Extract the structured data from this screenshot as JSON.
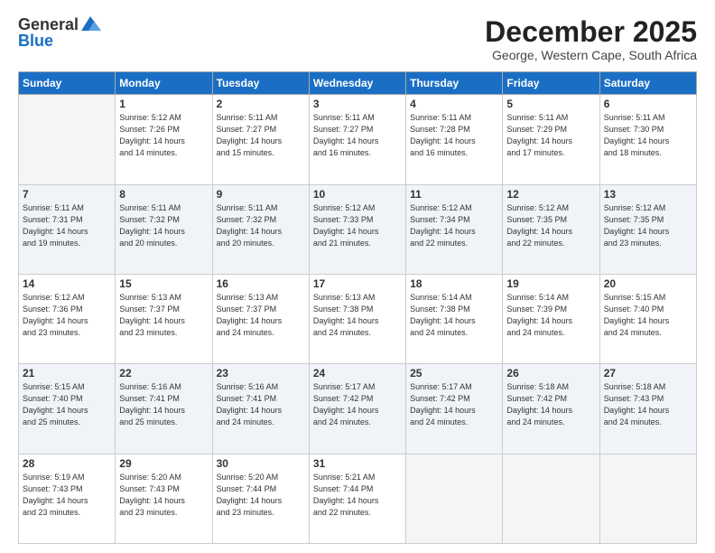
{
  "logo": {
    "general": "General",
    "blue": "Blue"
  },
  "title": "December 2025",
  "location": "George, Western Cape, South Africa",
  "days_of_week": [
    "Sunday",
    "Monday",
    "Tuesday",
    "Wednesday",
    "Thursday",
    "Friday",
    "Saturday"
  ],
  "weeks": [
    [
      {
        "day": "",
        "info": ""
      },
      {
        "day": "1",
        "info": "Sunrise: 5:12 AM\nSunset: 7:26 PM\nDaylight: 14 hours\nand 14 minutes."
      },
      {
        "day": "2",
        "info": "Sunrise: 5:11 AM\nSunset: 7:27 PM\nDaylight: 14 hours\nand 15 minutes."
      },
      {
        "day": "3",
        "info": "Sunrise: 5:11 AM\nSunset: 7:27 PM\nDaylight: 14 hours\nand 16 minutes."
      },
      {
        "day": "4",
        "info": "Sunrise: 5:11 AM\nSunset: 7:28 PM\nDaylight: 14 hours\nand 16 minutes."
      },
      {
        "day": "5",
        "info": "Sunrise: 5:11 AM\nSunset: 7:29 PM\nDaylight: 14 hours\nand 17 minutes."
      },
      {
        "day": "6",
        "info": "Sunrise: 5:11 AM\nSunset: 7:30 PM\nDaylight: 14 hours\nand 18 minutes."
      }
    ],
    [
      {
        "day": "7",
        "info": "Sunrise: 5:11 AM\nSunset: 7:31 PM\nDaylight: 14 hours\nand 19 minutes."
      },
      {
        "day": "8",
        "info": "Sunrise: 5:11 AM\nSunset: 7:32 PM\nDaylight: 14 hours\nand 20 minutes."
      },
      {
        "day": "9",
        "info": "Sunrise: 5:11 AM\nSunset: 7:32 PM\nDaylight: 14 hours\nand 20 minutes."
      },
      {
        "day": "10",
        "info": "Sunrise: 5:12 AM\nSunset: 7:33 PM\nDaylight: 14 hours\nand 21 minutes."
      },
      {
        "day": "11",
        "info": "Sunrise: 5:12 AM\nSunset: 7:34 PM\nDaylight: 14 hours\nand 22 minutes."
      },
      {
        "day": "12",
        "info": "Sunrise: 5:12 AM\nSunset: 7:35 PM\nDaylight: 14 hours\nand 22 minutes."
      },
      {
        "day": "13",
        "info": "Sunrise: 5:12 AM\nSunset: 7:35 PM\nDaylight: 14 hours\nand 23 minutes."
      }
    ],
    [
      {
        "day": "14",
        "info": "Sunrise: 5:12 AM\nSunset: 7:36 PM\nDaylight: 14 hours\nand 23 minutes."
      },
      {
        "day": "15",
        "info": "Sunrise: 5:13 AM\nSunset: 7:37 PM\nDaylight: 14 hours\nand 23 minutes."
      },
      {
        "day": "16",
        "info": "Sunrise: 5:13 AM\nSunset: 7:37 PM\nDaylight: 14 hours\nand 24 minutes."
      },
      {
        "day": "17",
        "info": "Sunrise: 5:13 AM\nSunset: 7:38 PM\nDaylight: 14 hours\nand 24 minutes."
      },
      {
        "day": "18",
        "info": "Sunrise: 5:14 AM\nSunset: 7:38 PM\nDaylight: 14 hours\nand 24 minutes."
      },
      {
        "day": "19",
        "info": "Sunrise: 5:14 AM\nSunset: 7:39 PM\nDaylight: 14 hours\nand 24 minutes."
      },
      {
        "day": "20",
        "info": "Sunrise: 5:15 AM\nSunset: 7:40 PM\nDaylight: 14 hours\nand 24 minutes."
      }
    ],
    [
      {
        "day": "21",
        "info": "Sunrise: 5:15 AM\nSunset: 7:40 PM\nDaylight: 14 hours\nand 25 minutes."
      },
      {
        "day": "22",
        "info": "Sunrise: 5:16 AM\nSunset: 7:41 PM\nDaylight: 14 hours\nand 25 minutes."
      },
      {
        "day": "23",
        "info": "Sunrise: 5:16 AM\nSunset: 7:41 PM\nDaylight: 14 hours\nand 24 minutes."
      },
      {
        "day": "24",
        "info": "Sunrise: 5:17 AM\nSunset: 7:42 PM\nDaylight: 14 hours\nand 24 minutes."
      },
      {
        "day": "25",
        "info": "Sunrise: 5:17 AM\nSunset: 7:42 PM\nDaylight: 14 hours\nand 24 minutes."
      },
      {
        "day": "26",
        "info": "Sunrise: 5:18 AM\nSunset: 7:42 PM\nDaylight: 14 hours\nand 24 minutes."
      },
      {
        "day": "27",
        "info": "Sunrise: 5:18 AM\nSunset: 7:43 PM\nDaylight: 14 hours\nand 24 minutes."
      }
    ],
    [
      {
        "day": "28",
        "info": "Sunrise: 5:19 AM\nSunset: 7:43 PM\nDaylight: 14 hours\nand 23 minutes."
      },
      {
        "day": "29",
        "info": "Sunrise: 5:20 AM\nSunset: 7:43 PM\nDaylight: 14 hours\nand 23 minutes."
      },
      {
        "day": "30",
        "info": "Sunrise: 5:20 AM\nSunset: 7:44 PM\nDaylight: 14 hours\nand 23 minutes."
      },
      {
        "day": "31",
        "info": "Sunrise: 5:21 AM\nSunset: 7:44 PM\nDaylight: 14 hours\nand 22 minutes."
      },
      {
        "day": "",
        "info": ""
      },
      {
        "day": "",
        "info": ""
      },
      {
        "day": "",
        "info": ""
      }
    ]
  ]
}
